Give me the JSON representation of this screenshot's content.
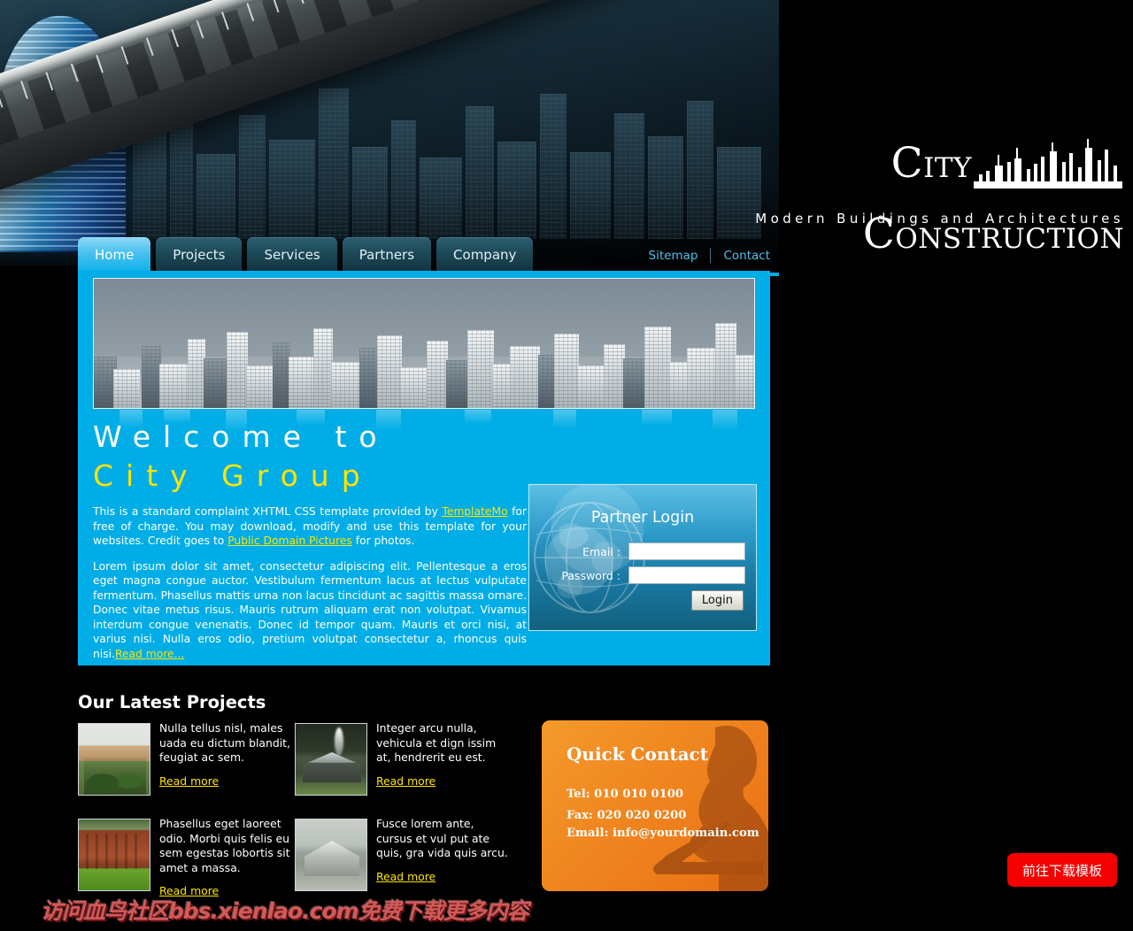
{
  "site": {
    "logo_line1": "CITY",
    "logo_line1_cap": "C",
    "logo_line1_rest": "ITY",
    "logo_line2_cap": "C",
    "logo_line2_rest": "ONSTRUCTION",
    "tagline": "Modern Buildings and Architectures"
  },
  "nav": {
    "tabs": [
      {
        "label": "Home",
        "active": true
      },
      {
        "label": "Projects",
        "active": false
      },
      {
        "label": "Services",
        "active": false
      },
      {
        "label": "Partners",
        "active": false
      },
      {
        "label": "Company",
        "active": false
      }
    ],
    "links": [
      {
        "label": "Sitemap"
      },
      {
        "label": "Contact"
      }
    ]
  },
  "hero": {
    "welcome_line1": "Welcome to",
    "welcome_line2": "City Group",
    "paragraph1_pre": "This is a standard complaint XHTML CSS template provided by ",
    "paragraph1_link1": "TemplateMo",
    "paragraph1_mid": " for free of charge. You may download, modify and use this template for your websites. Credit goes to ",
    "paragraph1_link2": "Public Domain Pictures",
    "paragraph1_post": " for photos.",
    "paragraph2": "Lorem ipsum dolor sit amet, consectetur adipiscing elit. Pellentesque a eros eget magna congue auctor. Vestibulum fermentum lacus at lectus vulputate fermentum. Phasellus mattis urna non lacus tincidunt ac sagittis massa ornare. Donec vitae metus risus. Mauris rutrum aliquam erat non volutpat. Vivamus interdum congue venenatis. Donec id tempor quam. Mauris et orci nisi, at varius nisi. Nulla eros odio, pretium volutpat consectetur a, rhoncus quis nisi.",
    "read_more": "Read more..."
  },
  "login": {
    "title": "Partner Login",
    "email_label": "Email :",
    "email_value": "",
    "password_label": "Password :",
    "password_value": "",
    "button_label": "Login"
  },
  "projects": {
    "heading": "Our Latest Projects",
    "items": [
      {
        "text": "Nulla tellus nisl, males uada eu dictum blandit, feugiat ac sem.",
        "link": "Read more"
      },
      {
        "text": "Integer arcu nulla, vehicula et dign issim at, hendrerit eu est.",
        "link": "Read more"
      },
      {
        "text": "Phasellus eget laoreet odio. Morbi quis felis eu sem egestas lobortis sit amet a massa.",
        "link": "Read more"
      },
      {
        "text": "Fusce lorem ante, cursus et vul put ate quis, gra vida quis arcu.",
        "link": "Read more"
      }
    ]
  },
  "quick_contact": {
    "title": "Quick Contact",
    "tel": "Tel: 010 010 0100",
    "fax": "Fax: 020 020 0200",
    "email": "Email: info@yourdomain.com"
  },
  "overlay": {
    "watermark": "访问血鸟社区bbs.xienlao.com免费下载更多内容",
    "download_button": "前往下载模板"
  },
  "colors": {
    "cyan": "#00ADE6",
    "yellow": "#FFE400",
    "orange": "#F08A22",
    "red": "#F40000",
    "nav_dark": "#1D4957"
  }
}
